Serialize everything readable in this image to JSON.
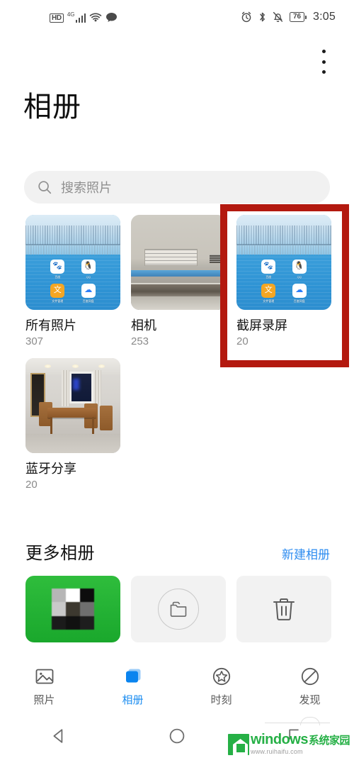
{
  "statusbar": {
    "hd_label": "HD",
    "network_label": "4G",
    "signal_icon": "signal-bars-icon",
    "wifi_icon": "wifi-icon",
    "message_icon": "message-bubble-icon",
    "alarm_icon": "alarm-clock-icon",
    "bluetooth_icon": "bluetooth-icon",
    "silent_icon": "bell-muted-icon",
    "battery_level": "76",
    "time": "3:05"
  },
  "header": {
    "title": "相册",
    "overflow_menu_icon": "more-vertical-icon"
  },
  "search": {
    "icon": "search-icon",
    "placeholder": "搜索照片"
  },
  "albums": [
    {
      "name": "所有照片",
      "count": "307",
      "thumb": "home-screen-screenshot"
    },
    {
      "name": "相机",
      "count": "253",
      "thumb": "machine-label-photo"
    },
    {
      "name": "截屏录屏",
      "count": "20",
      "thumb": "home-screen-screenshot",
      "highlighted": true
    },
    {
      "name": "蓝牙分享",
      "count": "20",
      "thumb": "dining-room-photo"
    }
  ],
  "home_screen_apps": [
    {
      "label": "百度",
      "glyph": "🐾"
    },
    {
      "label": "QQ",
      "glyph": "🐧"
    },
    {
      "label": "文件管理",
      "glyph": "文"
    },
    {
      "label": "百度网盘",
      "glyph": "☁"
    }
  ],
  "annotation": {
    "color": "#b3190f",
    "target": "截屏录屏"
  },
  "more_albums": {
    "title": "更多相册",
    "action_label": "新建相册",
    "tiles": [
      {
        "name": "wechat-green-thumbnail",
        "icon": ""
      },
      {
        "name": "new-folder-tile",
        "icon": "folder-icon"
      },
      {
        "name": "recycle-bin-tile",
        "icon": "trash-icon"
      }
    ]
  },
  "bottom_nav": [
    {
      "label": "照片",
      "icon": "photo-icon",
      "active": false
    },
    {
      "label": "相册",
      "icon": "albums-stack-icon",
      "active": true
    },
    {
      "label": "时刻",
      "icon": "star-circle-icon",
      "active": false
    },
    {
      "label": "发现",
      "icon": "discover-icon",
      "active": false
    }
  ],
  "system_nav": [
    {
      "name": "back-button",
      "icon": "triangle-back-icon"
    },
    {
      "name": "home-button",
      "icon": "circle-home-icon"
    },
    {
      "name": "recents-button",
      "icon": "square-recents-icon"
    }
  ],
  "watermark": {
    "brand": "windows",
    "brand_cn": "系统家园",
    "url": "www.ruihaifu.com"
  },
  "colors": {
    "accent_blue": "#1a8cf0",
    "link_blue": "#2d8cf0",
    "annotation_red": "#b3190f",
    "green_tile": "#22b033"
  }
}
